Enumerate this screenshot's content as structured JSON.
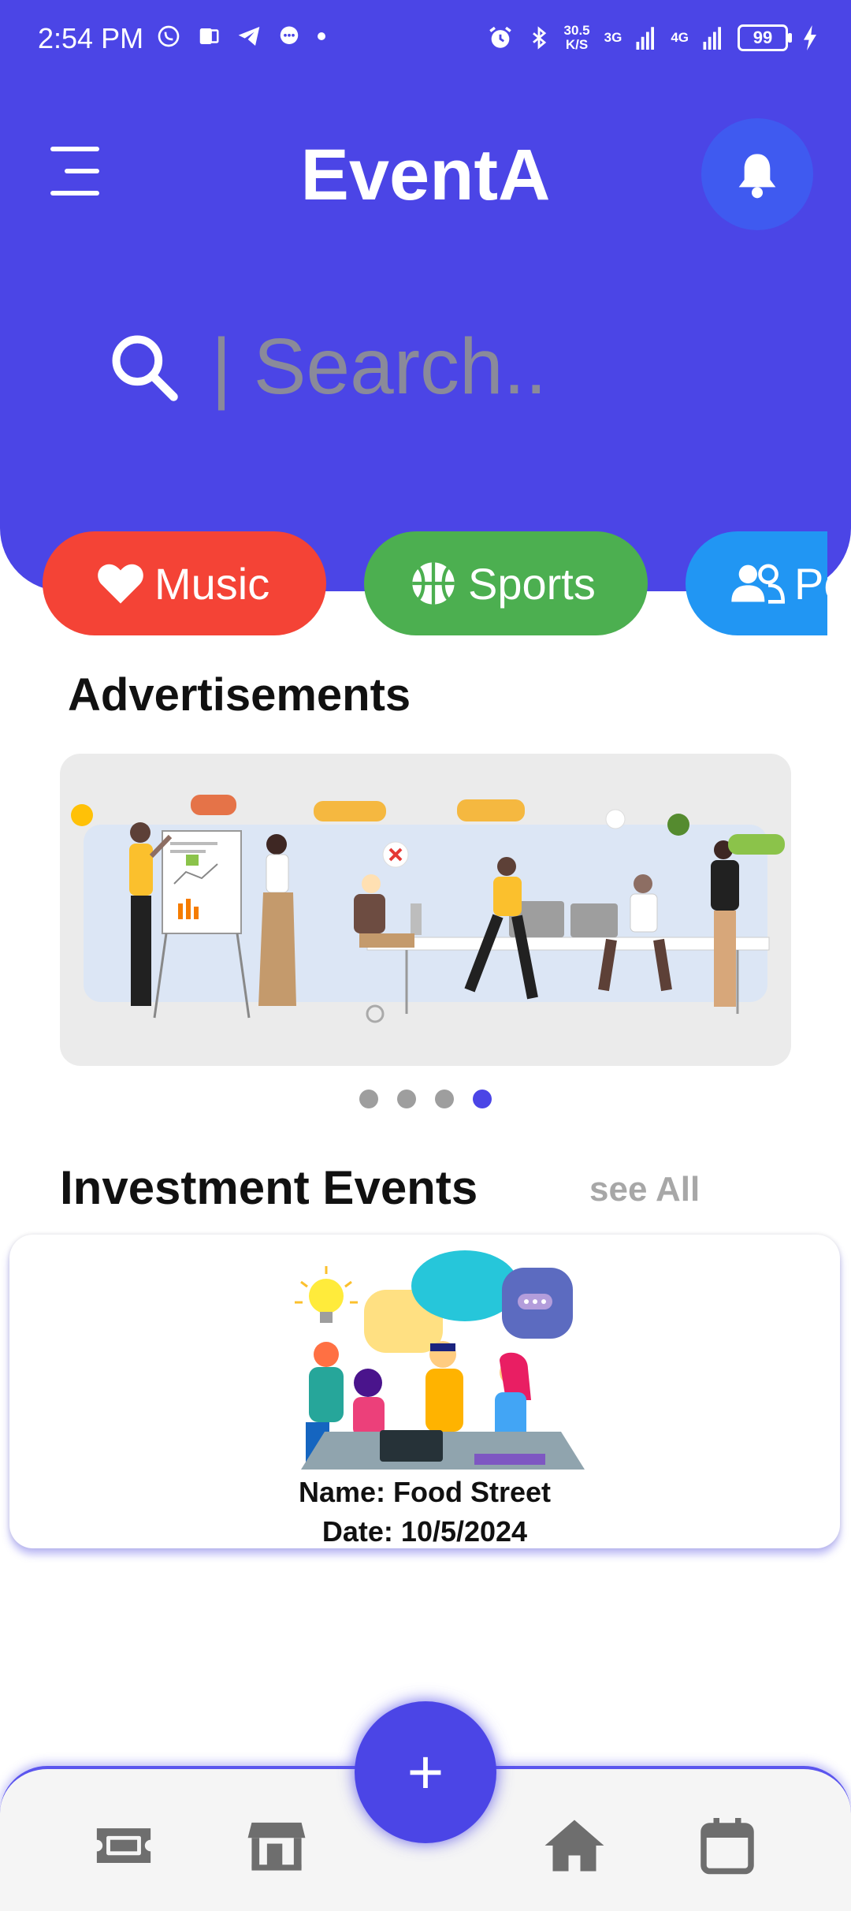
{
  "status_bar": {
    "time": "2:54 PM",
    "net_speed_value": "30.5",
    "net_speed_unit": "K/S",
    "sig1": "3G",
    "sig2": "4G",
    "battery": "99"
  },
  "header": {
    "title": "EventA",
    "search_placeholder": "| Search.."
  },
  "categories": [
    {
      "label": "Music",
      "icon": "heart-icon",
      "color": "#F44336"
    },
    {
      "label": "Sports",
      "icon": "basketball-icon",
      "color": "#4CAF50"
    },
    {
      "label": "Po",
      "icon": "people-icon",
      "color": "#2196F3"
    }
  ],
  "ads": {
    "title": "Advertisements",
    "slide_count": 4,
    "active_slide": 4
  },
  "investment": {
    "title": "Investment Events",
    "see_all": "see All",
    "event": {
      "name": "Name: Food Street",
      "date": "Date: 10/5/2024"
    }
  },
  "bottom_nav": {
    "items": [
      "ticket-icon",
      "store-icon",
      "add-icon",
      "home-icon",
      "calendar-icon"
    ],
    "fab_label": "+"
  },
  "colors": {
    "primary": "#4B45E6",
    "music": "#F44336",
    "sports": "#4CAF50",
    "people": "#2196F3"
  }
}
